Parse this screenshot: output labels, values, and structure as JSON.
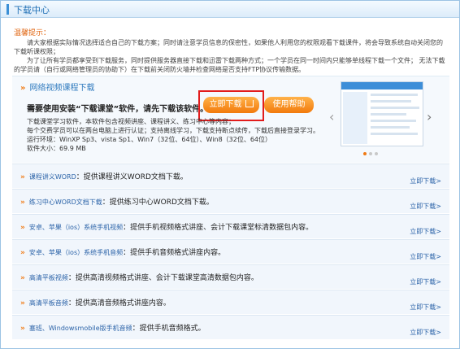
{
  "header": {
    "title": "下载中心"
  },
  "tips": {
    "label": "温馨提示：",
    "line1": "请大家根据实际情况选择适合自己的下载方案；同时请注意学员信息的保密性，如果他人利用您的权限观看下载课件，将会导致系统自动关闭您的下载听课权限；",
    "line2": "为了让所有学员都享受到下载服务，同时提供服务器直接下载和迅雷下载两种方式；一个学员在同一时间内只能够单线程下载一个文件； 无法下载的学员请（自行或网络管理员的协助下）在下载前关闭防火墙并检查网络是否支持FTP协议传输数据。"
  },
  "section1": {
    "heading": "网络视频课程下载",
    "need": "需要使用安装“下载课堂”软件，请先下载该软件。",
    "download_btn": "立即下载",
    "help_btn": "使用帮助",
    "desc1": "下载课堂学习软件，本软件包含视频讲座、课程讲义、练习中心等内容；",
    "desc2": "每个交费学员可以在两台电脑上进行认证；支持离线学习，下载支持断点续传，下载后直接登录学习。",
    "desc3": "运行环境：WinXP Sp3、vista Sp1、Win7（32位、64位）、Win8（32位、64位）",
    "desc4": "软件大小：69.9 MB"
  },
  "rows": [
    {
      "name": "课程讲义WORD",
      "desc": "：提供课程讲义WORD文档下载。",
      "link": "立即下载>"
    },
    {
      "name": "练习中心WORD文档下载",
      "desc": "：提供练习中心WORD文档下载。",
      "link": "立即下载>"
    },
    {
      "name": "安卓、苹果（ios）系统手机视频",
      "desc": "：提供手机视频格式讲座、会计下载课堂标清数据包内容。",
      "link": "立即下载>"
    },
    {
      "name": "安卓、苹果（ios）系统手机音频",
      "desc": "：提供手机音频格式讲座内容。",
      "link": "立即下载>"
    },
    {
      "name": "高清平板视频",
      "desc": "：提供高清视频格式讲座、会计下载课堂高清数据包内容。",
      "link": "立即下载>"
    },
    {
      "name": "高清平板音频",
      "desc": "：提供高清音频格式讲座内容。",
      "link": "立即下载>"
    },
    {
      "name": "塞班、Windowsmobile版手机音频",
      "desc": "：提供手机音频格式。",
      "link": "立即下载>"
    }
  ]
}
